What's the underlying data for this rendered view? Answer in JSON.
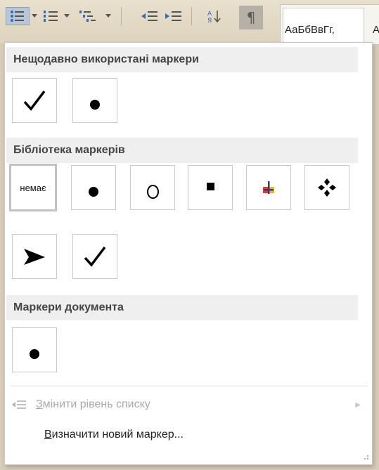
{
  "ribbon": {
    "style_preview_text": "АаБбВвГг,",
    "style_preview_next": "А"
  },
  "menu": {
    "recent": {
      "title": "Нещодавно використані маркери",
      "items": [
        "check-mark-bullet",
        "black-dot-bullet"
      ]
    },
    "library": {
      "title": "Бібліотека маркерів",
      "none_label": "немає",
      "items": [
        "none",
        "black-dot-bullet",
        "hollow-circle-bullet",
        "black-square-bullet",
        "colored-plus-bullet",
        "four-diamond-bullet",
        "arrowhead-bullet",
        "check-mark-bullet"
      ]
    },
    "document": {
      "title": "Маркери документа",
      "items": [
        "black-dot-bullet"
      ]
    },
    "change_level": {
      "icon": "change-list-level-icon",
      "label_underlined": "З",
      "label_rest": "мінити рівень списку"
    },
    "define_new": {
      "label_underlined": "В",
      "label_rest": "изначити новий маркер..."
    }
  }
}
